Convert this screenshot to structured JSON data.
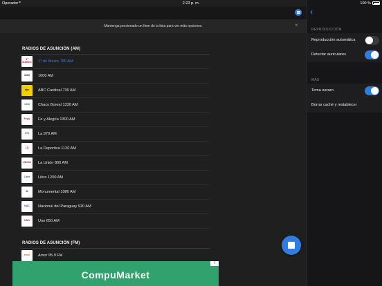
{
  "status_bar": {
    "carrier": "Operador",
    "time": "2:23 p. m.",
    "battery_percent": "100 %"
  },
  "main": {
    "hint": "Mantenga presionado un ítem de la lista para ver más opciones.",
    "close_glyph": "×",
    "sections": [
      {
        "title": "RADIOS DE ASUNCIÓN (AM)",
        "stations": [
          {
            "name": "1° de Marzo 780 AM",
            "logo_text": "1° MARZO",
            "logo_color": "#c8102e",
            "playing": true
          },
          {
            "name": "1000 AM",
            "logo_text": "1000",
            "logo_color": "#1a1a1a",
            "playing": false
          },
          {
            "name": "ABC Cardinal 730 AM",
            "logo_text": "abc",
            "logo_color": "#111111",
            "logo_bg": "#f5d000",
            "playing": false
          },
          {
            "name": "Chaco Boreal 1330 AM",
            "logo_text": "1330",
            "logo_color": "#1d8a3a",
            "playing": false
          },
          {
            "name": "Fe y Alegría 1300 AM",
            "logo_text": "FeyA",
            "logo_color": "#d02030",
            "playing": false
          },
          {
            "name": "La 970 AM",
            "logo_text": "970",
            "logo_color": "#c0102a",
            "playing": false
          },
          {
            "name": "La Deportiva 1120 AM",
            "logo_text": "LD",
            "logo_color": "#e0203a",
            "playing": false
          },
          {
            "name": "La Unión 800 AM",
            "logo_text": "UNION",
            "logo_color": "#b01840",
            "playing": false
          },
          {
            "name": "Libre 1200 AM",
            "logo_text": "Libre",
            "logo_color": "#1a64c0",
            "playing": false
          },
          {
            "name": "Monumental 1080 AM",
            "logo_text": "M",
            "logo_color": "#2a2a6a",
            "playing": false
          },
          {
            "name": "Nacional del Paraguay 920 AM",
            "logo_text": "NAC",
            "logo_color": "#2a4aa0",
            "playing": false
          },
          {
            "name": "Uno 650 AM",
            "logo_text": "UNO",
            "logo_color": "#d01a1a",
            "playing": false
          }
        ]
      },
      {
        "title": "RADIOS DE ASUNCIÓN (FM)",
        "stations": [
          {
            "name": "Amor 95.9 FM",
            "logo_text": "amor",
            "logo_color": "#c87a10",
            "playing": false
          }
        ]
      }
    ],
    "ad": {
      "text": "CompuMarket",
      "close_label": "X"
    }
  },
  "settings": {
    "back_glyph": "‹",
    "sections": [
      {
        "header": "REPRODUCCIÓN",
        "rows": [
          {
            "label": "Reproducción automática",
            "toggle": false
          },
          {
            "label": "Detectar auriculares",
            "toggle": true
          }
        ]
      },
      {
        "header": "MÁS",
        "rows": [
          {
            "label": "Tema oscuro",
            "toggle": true
          },
          {
            "label": "Borrar caché y restablecer"
          }
        ]
      }
    ]
  },
  "colors": {
    "accent": "#2f7de1",
    "ad_green": "#31a26e",
    "playing_text": "#3d7fd6"
  }
}
